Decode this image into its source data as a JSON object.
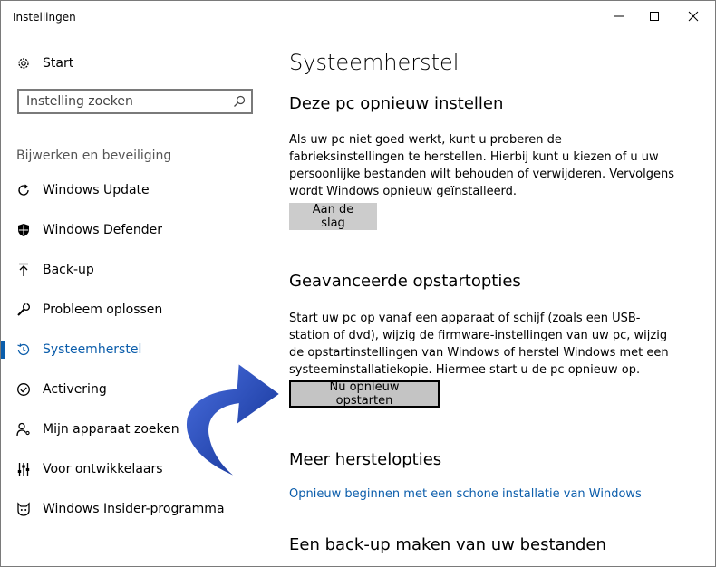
{
  "window": {
    "title": "Instellingen"
  },
  "sidebar": {
    "home_label": "Start",
    "search_placeholder": "Instelling zoeken",
    "section_label": "Bijwerken en beveiliging",
    "items": [
      {
        "label": "Windows Update",
        "icon": "refresh-icon"
      },
      {
        "label": "Windows Defender",
        "icon": "shield-icon"
      },
      {
        "label": "Back-up",
        "icon": "upload-arrow-icon"
      },
      {
        "label": "Probleem oplossen",
        "icon": "wrench-icon"
      },
      {
        "label": "Systeemherstel",
        "icon": "history-icon",
        "active": true
      },
      {
        "label": "Activering",
        "icon": "checkmark-circle-icon"
      },
      {
        "label": "Mijn apparaat zoeken",
        "icon": "person-pin-icon"
      },
      {
        "label": "Voor ontwikkelaars",
        "icon": "sliders-icon"
      },
      {
        "label": "Windows Insider-programma",
        "icon": "insider-cat-icon"
      }
    ]
  },
  "main": {
    "title": "Systeemherstel",
    "reset": {
      "heading": "Deze pc opnieuw instellen",
      "description": "Als uw pc niet goed werkt, kunt u proberen de fabrieksinstellingen te herstellen. Hierbij kunt u kiezen of u uw persoonlijke bestanden wilt behouden of verwijderen. Vervolgens wordt Windows opnieuw geïnstalleerd.",
      "button": "Aan de slag"
    },
    "advanced": {
      "heading": "Geavanceerde opstartopties",
      "description": "Start uw pc op vanaf een apparaat of schijf (zoals een USB-station of dvd), wijzig de firmware-instellingen van uw pc, wijzig de opstartinstellingen van Windows of herstel Windows met een systeeminstallatiekopie. Hiermee start u de pc opnieuw op.",
      "button": "Nu opnieuw opstarten"
    },
    "more": {
      "heading": "Meer herstelopties",
      "link": "Opnieuw beginnen met een schone installatie van Windows"
    },
    "backup": {
      "heading": "Een back-up maken van uw bestanden"
    }
  },
  "colors": {
    "accent": "#0b5dab",
    "arrow": "#0f2e8f"
  }
}
